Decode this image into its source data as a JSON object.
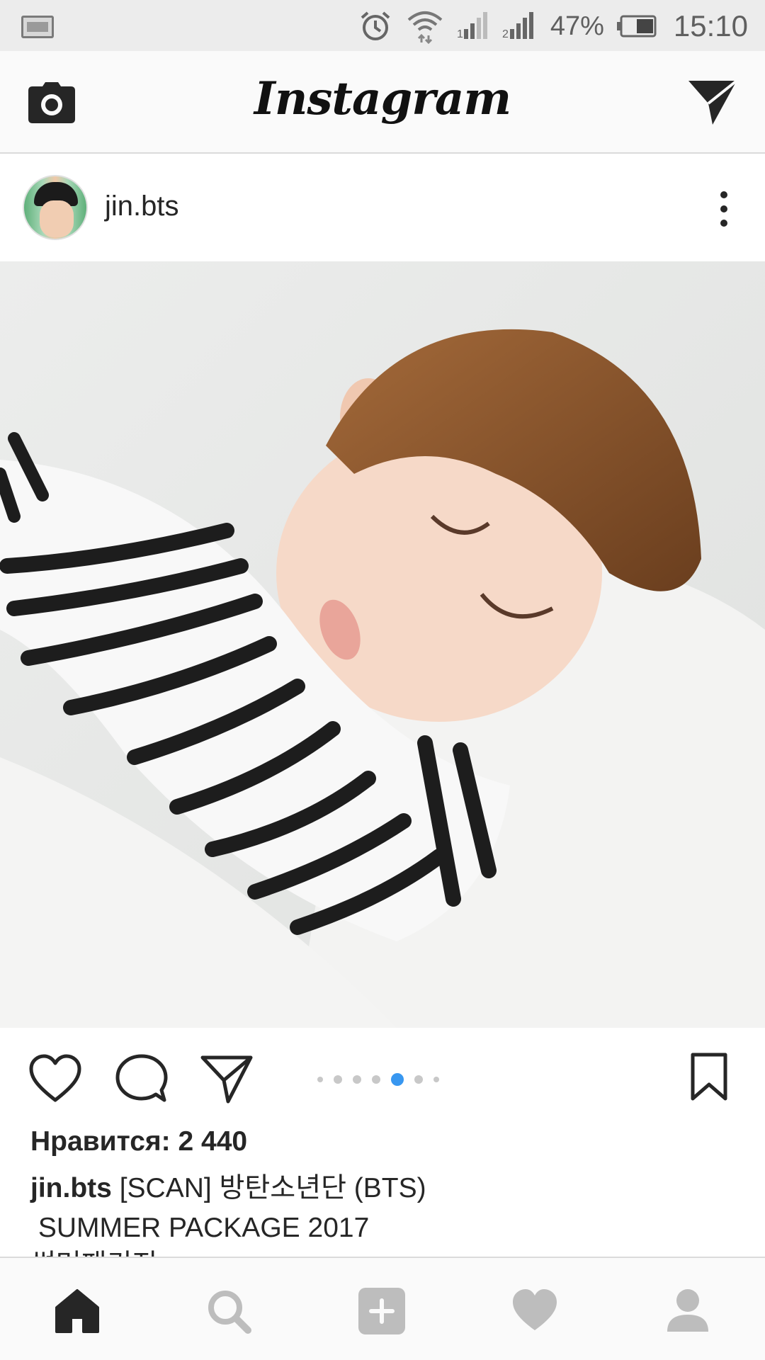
{
  "status_bar": {
    "battery_percent": "47%",
    "time": "15:10",
    "icons": [
      "screenshot-icon",
      "alarm-icon",
      "wifi-icon",
      "signal-1-icon",
      "signal-2-icon",
      "battery-icon"
    ]
  },
  "header": {
    "logo_text": "Instagram",
    "icons": [
      "camera-icon",
      "direct-message-icon"
    ]
  },
  "post": {
    "username": "jin.bts",
    "image_description_icon": "post-photo",
    "carousel": {
      "count": 7,
      "active_index": 4
    },
    "likes": "Нравится: 2 440",
    "caption_user": "jin.bts",
    "caption_line1": "[SCAN] 방탄소년단 (BTS)",
    "caption_line2": " SUMMER PACKAGE 2017",
    "caption_line3": "썸머패키지"
  },
  "bottom_nav": {
    "items": [
      "home-icon",
      "search-icon",
      "add-post-icon",
      "activity-icon",
      "profile-icon"
    ]
  },
  "colors": {
    "accent_blue": "#3897f0",
    "text": "#262626",
    "header_bg": "#fafafa",
    "status_bg": "#ececec"
  }
}
